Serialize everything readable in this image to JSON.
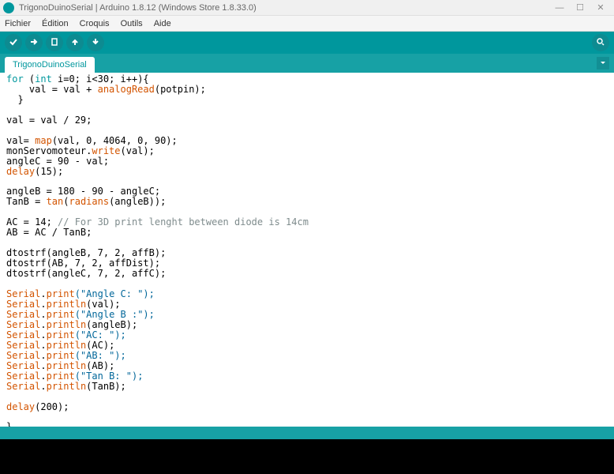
{
  "window": {
    "title": "TrigonoDuinoSerial | Arduino 1.8.12 (Windows Store 1.8.33.0)",
    "min": "—",
    "max": "☐",
    "close": "✕"
  },
  "menu": {
    "file": "Fichier",
    "edit": "Édition",
    "sketch": "Croquis",
    "tools": "Outils",
    "help": "Aide"
  },
  "tab": {
    "name": "TrigonoDuinoSerial"
  },
  "code": {
    "l01a": "for",
    "l01b": " (",
    "l01c": "int",
    "l01d": " i=0; i<30; i++){",
    "l02a": "    val = val + ",
    "l02b": "analogRead",
    "l02c": "(potpin);",
    "l03": "  }",
    "l05": "val = val / 29;",
    "l07a": "val= ",
    "l07b": "map",
    "l07c": "(val, 0, 4064, 0, 90);",
    "l08a": "monServomoteur.",
    "l08b": "write",
    "l08c": "(val);",
    "l09": "angleC = 90 - val;",
    "l10a": "delay",
    "l10b": "(15);",
    "l12": "angleB = 180 - 90 - angleC;",
    "l13a": "TanB = ",
    "l13b": "tan",
    "l13c": "(",
    "l13d": "radians",
    "l13e": "(angleB));",
    "l15a": "AC = 14; ",
    "l15b": "// For 3D print lenght between diode is 14cm",
    "l16": "AB = AC / TanB;",
    "l18": "dtostrf(angleB, 7, 2, affB);",
    "l19": "dtostrf(AB, 7, 2, affDist);",
    "l20": "dtostrf(angleC, 7, 2, affC);",
    "ser": "Serial",
    "pr": "print",
    "pl": "println",
    "s1": "(\"Angle C: \");",
    "s2": "(val);",
    "s3": "(\"Angle B :\");",
    "s4": "(angleB);",
    "s5": "(\"AC: \");",
    "s6": "(AC);",
    "s7": "(\"AB: \");",
    "s8": "(AB);",
    "s9": "(\"Tan B: \");",
    "s10": "(TanB);",
    "d200a": "delay",
    "d200b": "(200);",
    "end": "}"
  }
}
